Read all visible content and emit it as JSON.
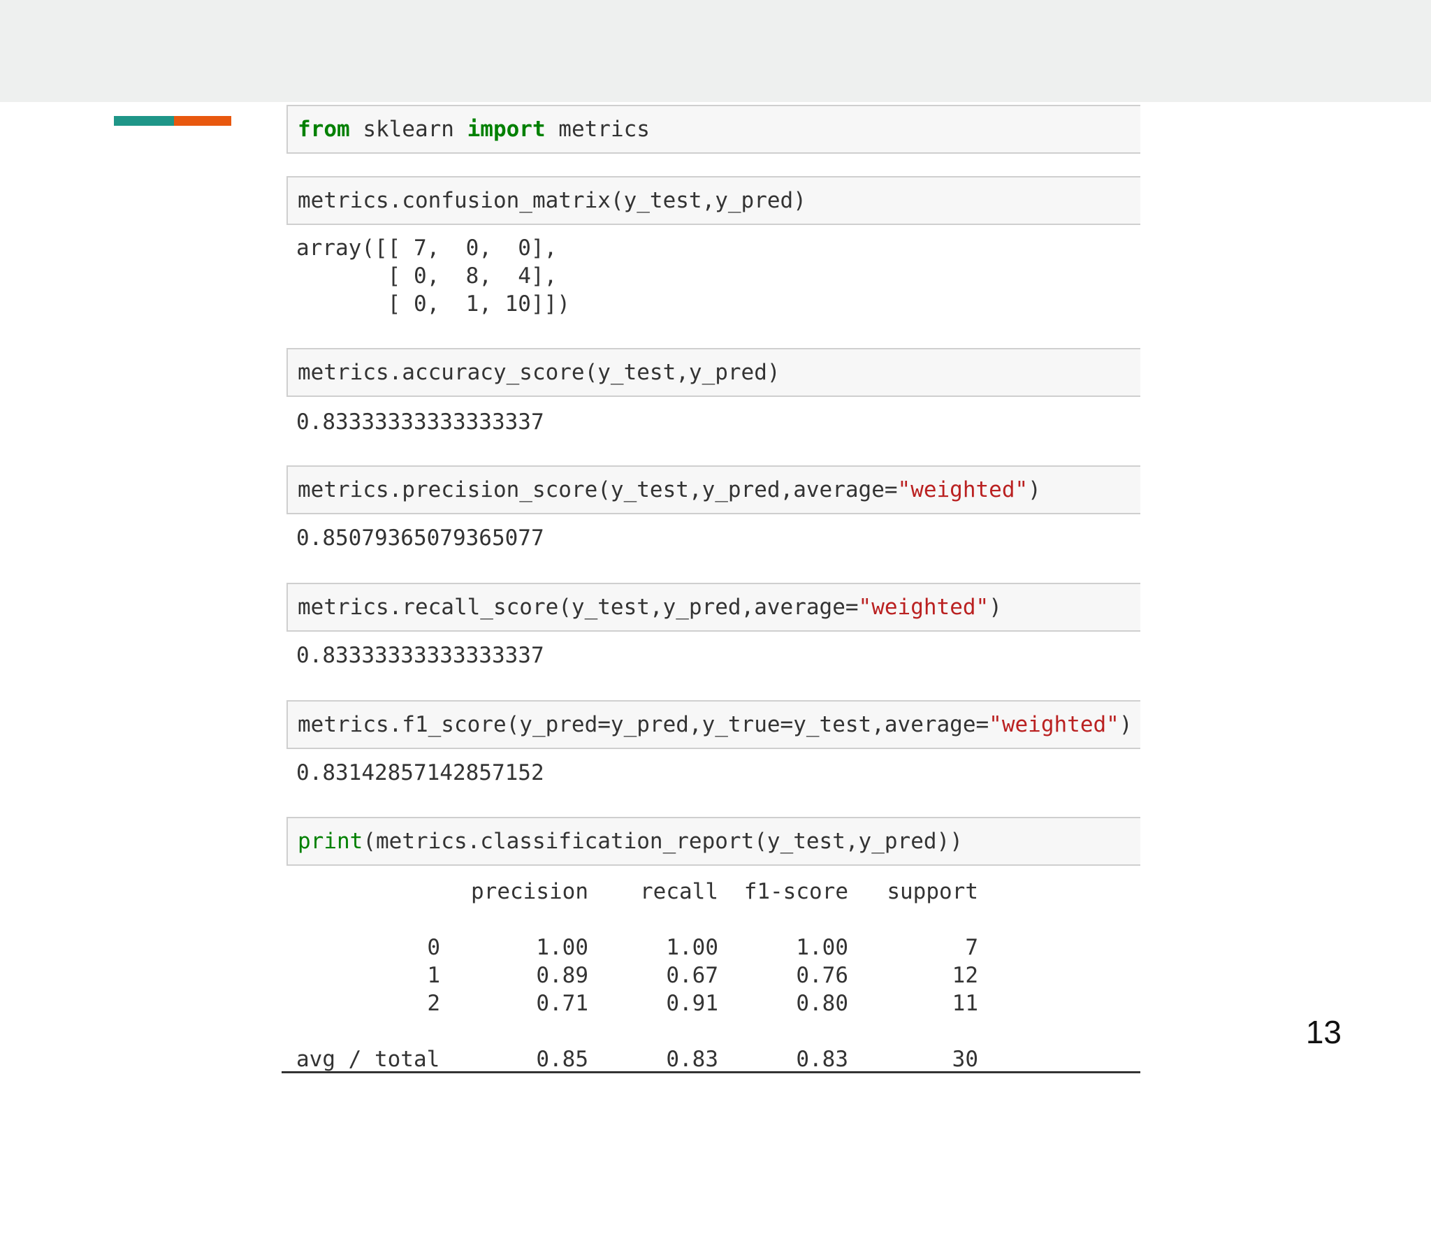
{
  "slide": {
    "page_number": "13",
    "accent_colors": [
      "#1f9688",
      "#e8580f"
    ]
  },
  "cells": [
    {
      "input": [
        {
          "text": "from",
          "style": "keyword"
        },
        {
          "text": " sklearn ",
          "style": "plain"
        },
        {
          "text": "import",
          "style": "keyword"
        },
        {
          "text": " metrics",
          "style": "plain"
        }
      ]
    },
    {
      "input": [
        {
          "text": "metrics.confusion_matrix(y_test,y_pred)",
          "style": "plain"
        }
      ],
      "output": "array([[ 7,  0,  0],\n       [ 0,  8,  4],\n       [ 0,  1, 10]])"
    },
    {
      "input": [
        {
          "text": "metrics.accuracy_score(y_test,y_pred)",
          "style": "plain"
        }
      ],
      "output": "0.83333333333333337"
    },
    {
      "input": [
        {
          "text": "metrics.precision_score(y_test,y_pred,average=",
          "style": "plain"
        },
        {
          "text": "\"weighted\"",
          "style": "string"
        },
        {
          "text": ")",
          "style": "plain"
        }
      ],
      "output": "0.85079365079365077"
    },
    {
      "input": [
        {
          "text": "metrics.recall_score(y_test,y_pred,average=",
          "style": "plain"
        },
        {
          "text": "\"weighted\"",
          "style": "string"
        },
        {
          "text": ")",
          "style": "plain"
        }
      ],
      "output": "0.83333333333333337"
    },
    {
      "input": [
        {
          "text": "metrics.f1_score(y_pred=y_pred,y_true=y_test,average=",
          "style": "plain"
        },
        {
          "text": "\"weighted\"",
          "style": "string"
        },
        {
          "text": ")",
          "style": "plain"
        }
      ],
      "output": "0.83142857142857152"
    },
    {
      "input": [
        {
          "text": "print",
          "style": "builtin"
        },
        {
          "text": "(metrics.classification_report(y_test,y_pred))",
          "style": "plain"
        }
      ]
    }
  ],
  "classification_report": {
    "headers": [
      "precision",
      "recall",
      "f1-score",
      "support"
    ],
    "rows": [
      {
        "label": "0",
        "values": [
          "1.00",
          "1.00",
          "1.00",
          "7"
        ]
      },
      {
        "label": "1",
        "values": [
          "0.89",
          "0.67",
          "0.76",
          "12"
        ]
      },
      {
        "label": "2",
        "values": [
          "0.71",
          "0.91",
          "0.80",
          "11"
        ]
      }
    ],
    "total": {
      "label": "avg / total",
      "values": [
        "0.85",
        "0.83",
        "0.83",
        "30"
      ]
    }
  }
}
